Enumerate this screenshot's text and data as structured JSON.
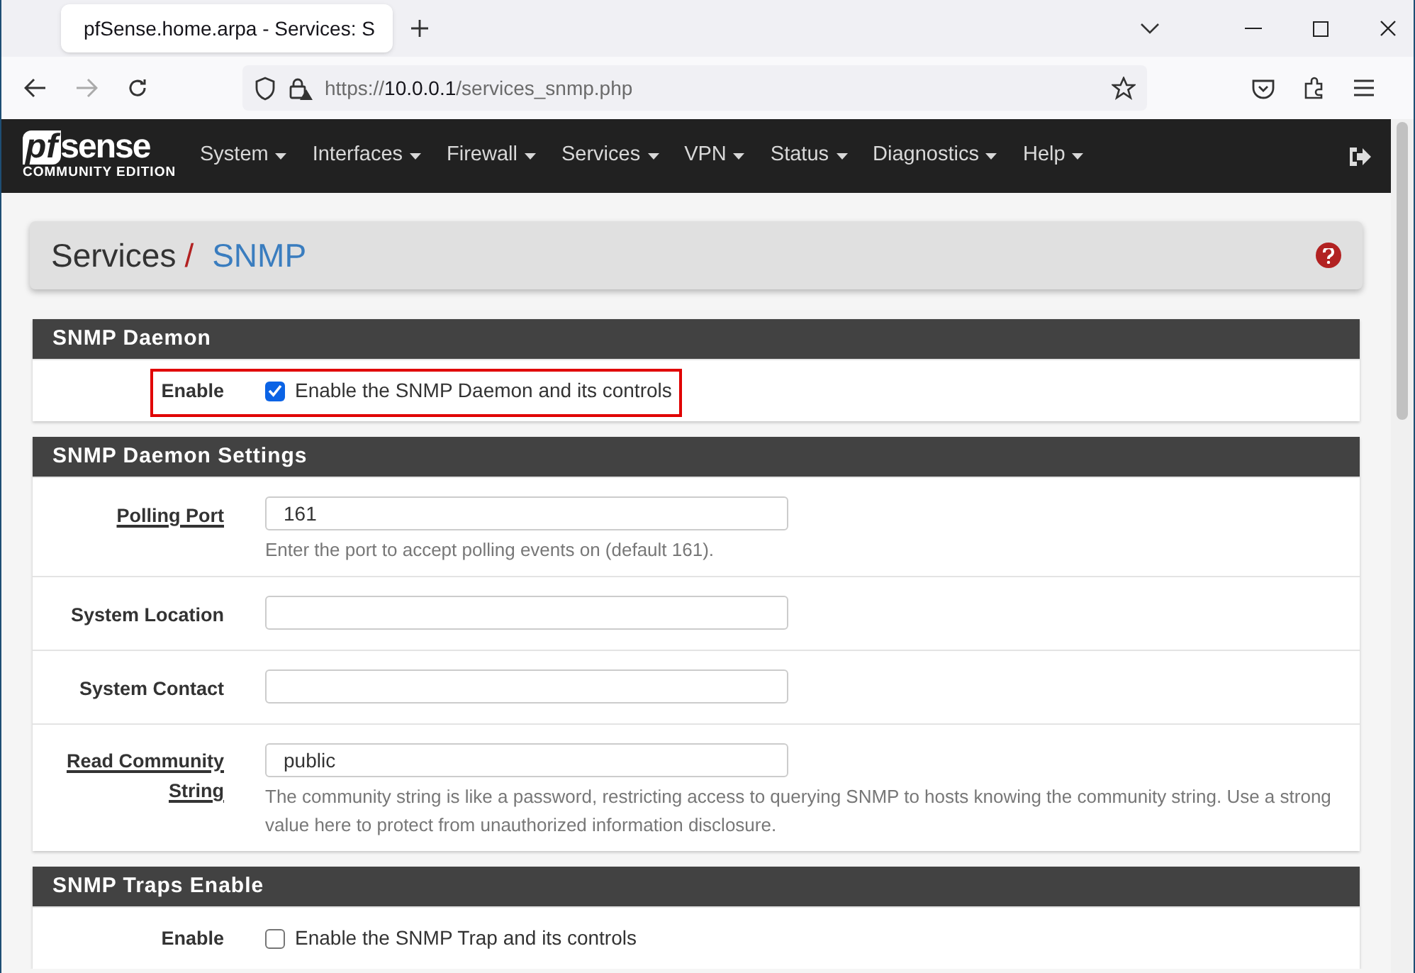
{
  "browser": {
    "tab": {
      "title": "pfSense.home.arpa - Services: S",
      "selected": true
    },
    "url": {
      "scheme": "https://",
      "host": "10.0.0.1",
      "path": "/services_snmp.php"
    }
  },
  "logo": {
    "mark": "pf",
    "word": "sense",
    "edition": "COMMUNITY EDITION"
  },
  "nav": [
    {
      "label": "System"
    },
    {
      "label": "Interfaces"
    },
    {
      "label": "Firewall"
    },
    {
      "label": "Services"
    },
    {
      "label": "VPN"
    },
    {
      "label": "Status"
    },
    {
      "label": "Diagnostics"
    },
    {
      "label": "Help"
    }
  ],
  "breadcrumb": {
    "parent": "Services",
    "separator": "/",
    "current": "SNMP"
  },
  "sections": [
    {
      "title": "SNMP Daemon",
      "rows": [
        {
          "kind": "checkbox",
          "label": "Enable",
          "has_help": false,
          "checked": true,
          "text": "Enable the SNMP Daemon and its controls",
          "highlighted": true
        }
      ]
    },
    {
      "title": "SNMP Daemon Settings",
      "rows": [
        {
          "kind": "input",
          "label": "Polling Port",
          "has_help": true,
          "value": "161",
          "help": "Enter the port to accept polling events on (default 161)."
        },
        {
          "kind": "input",
          "label": "System Location",
          "has_help": false
        },
        {
          "kind": "input",
          "label": "System Contact",
          "has_help": false
        },
        {
          "kind": "input",
          "label": "Read Community String",
          "has_help": true,
          "value": "public",
          "help": "The community string is like a password, restricting access to querying SNMP to hosts knowing the community string. Use a strong value here to protect from unauthorized information disclosure."
        }
      ]
    },
    {
      "title": "SNMP Traps Enable",
      "rows": [
        {
          "kind": "checkbox",
          "label": "Enable",
          "has_help": false,
          "checked": false,
          "text": "Enable the SNMP Trap and its controls",
          "highlighted": false
        }
      ]
    }
  ]
}
